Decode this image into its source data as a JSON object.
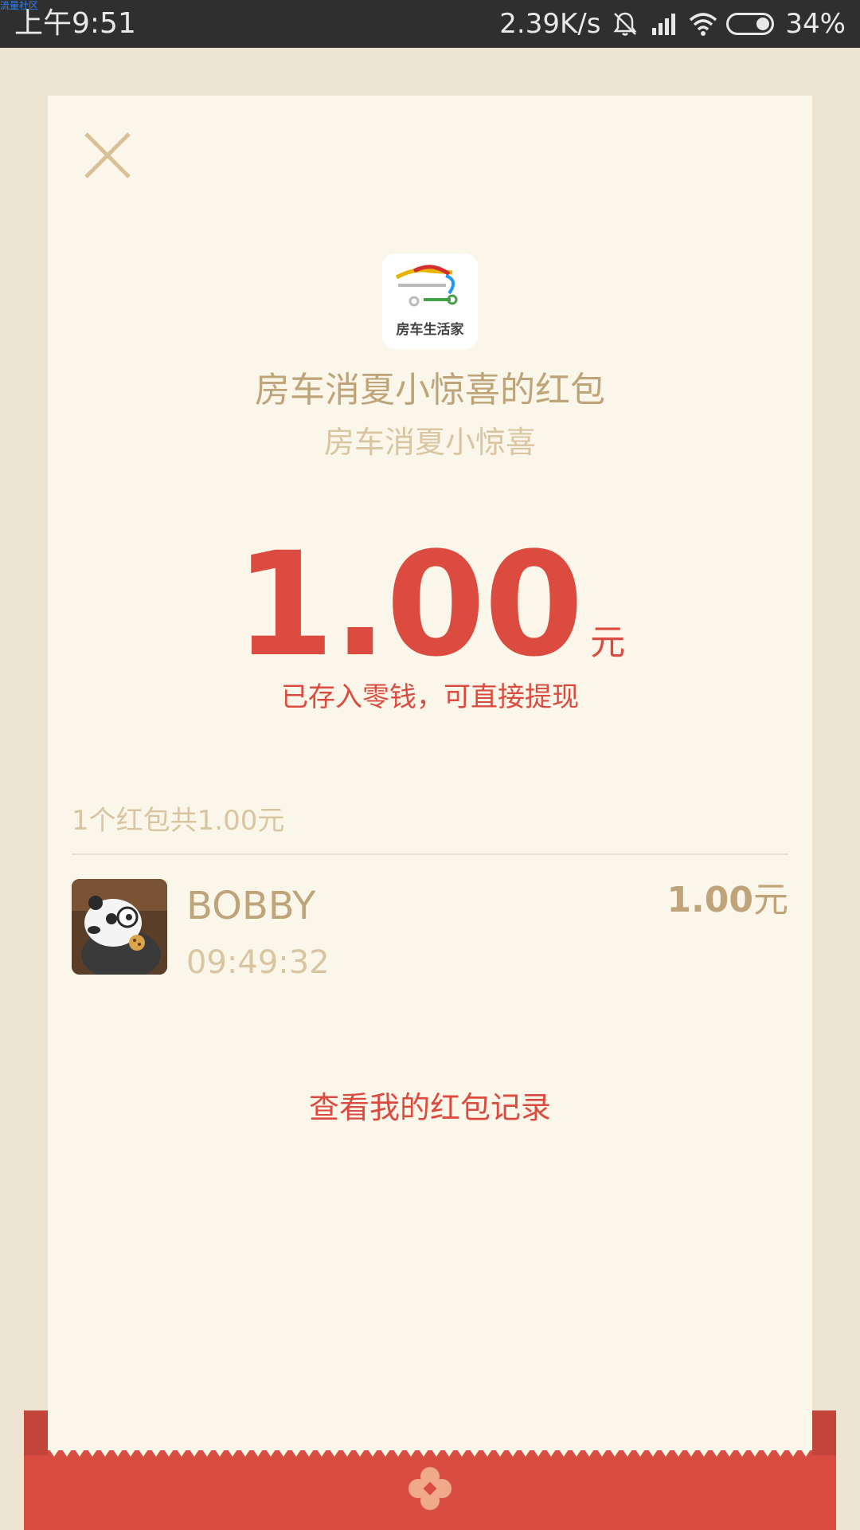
{
  "status_bar": {
    "corner_tag": "流量社区",
    "time": "上午9:51",
    "net_speed": "2.39K/s",
    "battery": "34%"
  },
  "card": {
    "logo_text": "房车生活家",
    "title": "房车消夏小惊喜的红包",
    "subtitle": "房车消夏小惊喜",
    "amount": "1.00",
    "amount_unit": "元",
    "stored_msg": "已存入零钱，可直接提现",
    "summary": "1个红包共1.00元",
    "record": {
      "name": "BOBBY",
      "time": "09:49:32",
      "amount": "1.00",
      "unit": "元"
    },
    "history_link": "查看我的红包记录"
  },
  "colors": {
    "accent_red": "#dc4b3f",
    "gold": "#bea478",
    "card_bg": "#faf6ea",
    "page_bg": "#ede4d1"
  },
  "icons": {
    "close": "close-icon",
    "mute": "bell-muted-icon",
    "signal": "signal-icon",
    "wifi": "wifi-icon",
    "battery": "battery-icon",
    "flower": "flower-icon"
  }
}
